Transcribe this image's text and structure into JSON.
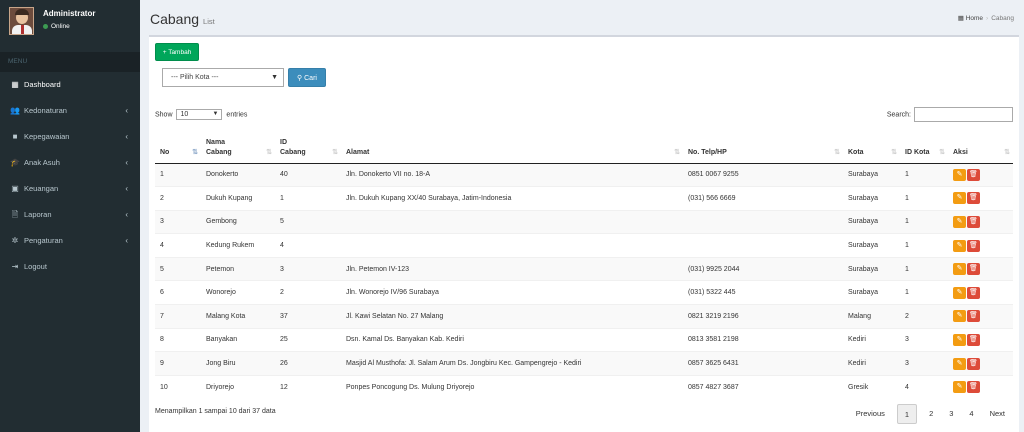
{
  "user": {
    "name": "Administrator",
    "status": "Online"
  },
  "sidebar": {
    "header": "MENU",
    "items": [
      {
        "label": "Dashboard",
        "icon": "dashboard-icon",
        "glyph": "▦",
        "chev": ""
      },
      {
        "label": "Kedonaturan",
        "icon": "users-icon",
        "glyph": "👥",
        "chev": "‹"
      },
      {
        "label": "Kepegawaian",
        "icon": "briefcase-icon",
        "glyph": "■",
        "chev": "‹"
      },
      {
        "label": "Anak Asuh",
        "icon": "graduation-cap-icon",
        "glyph": "🎓",
        "chev": "‹"
      },
      {
        "label": "Keuangan",
        "icon": "money-icon",
        "glyph": "▣",
        "chev": "‹"
      },
      {
        "label": "Laporan",
        "icon": "file-icon",
        "glyph": "🗎",
        "chev": "‹"
      },
      {
        "label": "Pengaturan",
        "icon": "gear-icon",
        "glyph": "✲",
        "chev": "‹"
      },
      {
        "label": "Logout",
        "icon": "sign-out-icon",
        "glyph": "⇥",
        "chev": ""
      }
    ]
  },
  "header": {
    "title": "Cabang",
    "subtitle": "List",
    "breadcrumb": {
      "home": "Home",
      "current": "Cabang"
    }
  },
  "toolbar": {
    "add_label": "Tambah",
    "city_placeholder": "--- Pilih Kota ---",
    "search_button": "Cari"
  },
  "table_controls": {
    "show_label": "Show",
    "entries_value": "10",
    "entries_label": "entries",
    "search_label": "Search:"
  },
  "table": {
    "columns": [
      {
        "label": "No",
        "key": "no"
      },
      {
        "label": "Nama Cabang",
        "key": "nama"
      },
      {
        "label": "ID Cabang",
        "key": "id"
      },
      {
        "label": "Alamat",
        "key": "alamat"
      },
      {
        "label": "No. Telp/HP",
        "key": "telp"
      },
      {
        "label": "Kota",
        "key": "kota"
      },
      {
        "label": "ID Kota",
        "key": "idkota"
      },
      {
        "label": "Aksi",
        "key": "aksi"
      }
    ],
    "rows": [
      {
        "no": "1",
        "nama": "Donokerto",
        "id": "40",
        "alamat": "Jln. Donokerto VII no. 18-A",
        "telp": "0851 0067 9255",
        "kota": "Surabaya",
        "idkota": "1"
      },
      {
        "no": "2",
        "nama": "Dukuh Kupang",
        "id": "1",
        "alamat": "Jln. Dukuh Kupang XX/40 Surabaya, Jatim-Indonesia",
        "telp": "(031) 566 6669",
        "kota": "Surabaya",
        "idkota": "1"
      },
      {
        "no": "3",
        "nama": "Gembong",
        "id": "5",
        "alamat": "",
        "telp": "",
        "kota": "Surabaya",
        "idkota": "1"
      },
      {
        "no": "4",
        "nama": "Kedung Rukem",
        "id": "4",
        "alamat": "",
        "telp": "",
        "kota": "Surabaya",
        "idkota": "1"
      },
      {
        "no": "5",
        "nama": "Petemon",
        "id": "3",
        "alamat": "Jln. Petemon IV-123",
        "telp": "(031) 9925 2044",
        "kota": "Surabaya",
        "idkota": "1"
      },
      {
        "no": "6",
        "nama": "Wonorejo",
        "id": "2",
        "alamat": "Jln. Wonorejo IV/96 Surabaya",
        "telp": "(031) 5322 445",
        "kota": "Surabaya",
        "idkota": "1"
      },
      {
        "no": "7",
        "nama": "Malang Kota",
        "id": "37",
        "alamat": "Jl. Kawi Selatan No. 27 Malang",
        "telp": "0821 3219 2196",
        "kota": "Malang",
        "idkota": "2"
      },
      {
        "no": "8",
        "nama": "Banyakan",
        "id": "25",
        "alamat": "Dsn. Kamal Ds. Banyakan Kab. Kediri",
        "telp": "0813 3581 2198",
        "kota": "Kediri",
        "idkota": "3"
      },
      {
        "no": "9",
        "nama": "Jong Biru",
        "id": "26",
        "alamat": "Masjid Al Musthofa: Jl. Salam Arum Ds. Jongbiru Kec. Gampengrejo - Kediri",
        "telp": "0857 3625 6431",
        "kota": "Kediri",
        "idkota": "3"
      },
      {
        "no": "10",
        "nama": "Driyorejo",
        "id": "12",
        "alamat": "Ponpes Poncogung Ds. Mulung Driyorejo",
        "telp": "0857 4827 3687",
        "kota": "Gresik",
        "idkota": "4"
      }
    ]
  },
  "footer": {
    "info": "Menampilkan 1 sampai 10 dari 37 data",
    "pagination": [
      "Previous",
      "1",
      "2",
      "3",
      "4",
      "Next"
    ],
    "current_page": "1"
  }
}
